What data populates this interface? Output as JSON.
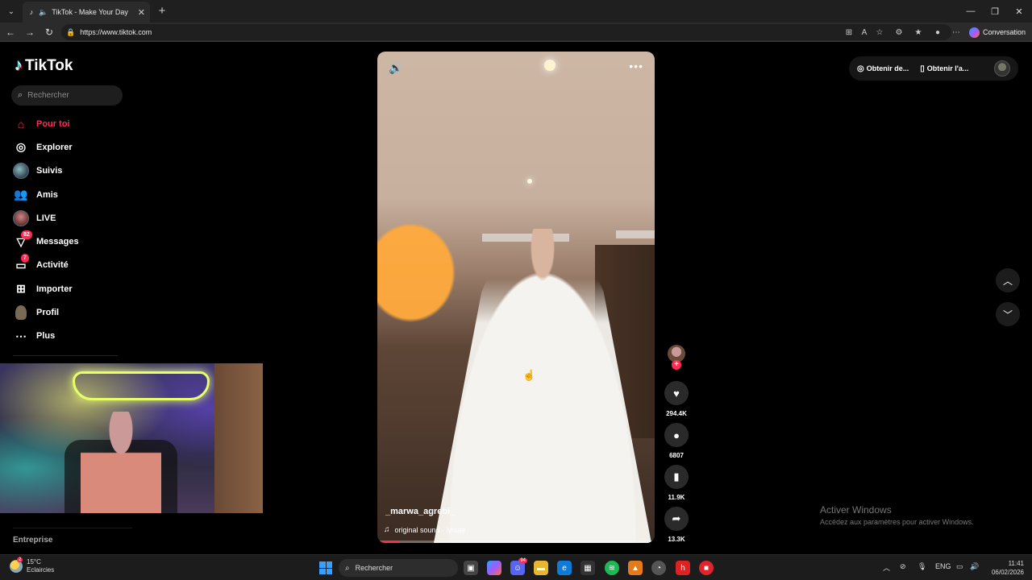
{
  "browser": {
    "tab_title": "TikTok - Make Your Day",
    "url": "https://www.tiktok.com",
    "conversation_label": "Conversation"
  },
  "tiktok": {
    "brand": "TikTok",
    "search_placeholder": "Rechercher",
    "nav": [
      {
        "label": "Pour toi",
        "icon": "home-icon"
      },
      {
        "label": "Explorer",
        "icon": "compass-icon"
      },
      {
        "label": "Suivis",
        "icon": "following-avatar-icon"
      },
      {
        "label": "Amis",
        "icon": "friends-icon"
      },
      {
        "label": "LIVE",
        "icon": "live-avatar-icon"
      },
      {
        "label": "Messages",
        "icon": "message-icon",
        "badge": "82"
      },
      {
        "label": "Activité",
        "icon": "activity-icon",
        "badge": "7"
      },
      {
        "label": "Importer",
        "icon": "upload-icon"
      },
      {
        "label": "Profil",
        "icon": "profile-avatar-icon"
      },
      {
        "label": "Plus",
        "icon": "more-icon"
      }
    ],
    "footer_label": "Entreprise",
    "top_right": {
      "coins_label": "Obtenir de...",
      "app_label": "Obtenir l'a..."
    },
    "video": {
      "username": "_marwa_agrebi_",
      "sound": "original sound - lyrsae",
      "progress": 0.08
    },
    "actions": {
      "likes": "294.4K",
      "comments": "6807",
      "saves": "11.9K",
      "shares": "13.3K"
    }
  },
  "watermark": {
    "title": "Activer Windows",
    "subtitle": "Accédez aux paramètres pour activer Windows."
  },
  "taskbar": {
    "weather_temp": "15°C",
    "weather_desc": "Eclaircies",
    "weather_badge": "2",
    "search_label": "Rechercher",
    "discord_badge": "94",
    "language": "ENG",
    "time": "11:41",
    "date": "06/02/2026"
  },
  "colors": {
    "accent": "#fe2c55",
    "background": "#000000"
  }
}
